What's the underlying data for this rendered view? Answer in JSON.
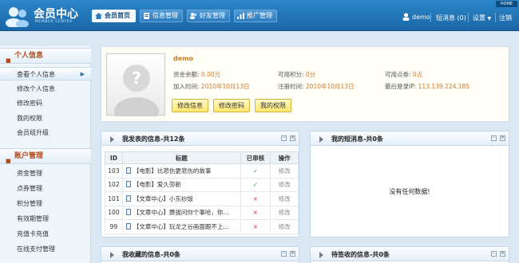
{
  "header": {
    "logo_title": "会员中心",
    "logo_subtitle": "MEMBER CENTER",
    "home_link": "HOME",
    "tabs": [
      {
        "label": "会员首页",
        "icon": "home-icon",
        "active": true
      },
      {
        "label": "信息管理",
        "icon": "document-icon",
        "active": false
      },
      {
        "label": "好友管理",
        "icon": "users-icon",
        "active": false
      },
      {
        "label": "推广管理",
        "icon": "chart-icon",
        "active": false
      }
    ],
    "username": "demo",
    "messages": "短消息 (0)",
    "settings": "设置",
    "logout": "注销"
  },
  "sidebar": {
    "sections": [
      {
        "title": "个人信息",
        "items": [
          "查看个人信息",
          "修改个人信息",
          "修改密码",
          "我的权限",
          "会员组升级"
        ]
      },
      {
        "title": "账户管理",
        "items": [
          "资金管理",
          "点券管理",
          "积分管理",
          "有效期管理",
          "充值卡充值",
          "在线支付管理"
        ]
      }
    ]
  },
  "profile": {
    "username": "demo",
    "balance_label": "资金余额:",
    "balance_value": "0.00元",
    "points_label": "可用积分:",
    "points_value": "0分",
    "coupons_label": "可用点券:",
    "coupons_value": "0点",
    "join_label": "加入时间:",
    "join_value": "2010年10月13日",
    "reg_label": "注册时间:",
    "reg_value": "2010年10月13日",
    "lastip_label": "最后登录IP:",
    "lastip_value": "113.139.224.185",
    "buttons": [
      "修改信息",
      "修改密码",
      "我的权限"
    ]
  },
  "panels": {
    "published": {
      "title": "我发表的信息-共12条",
      "columns": [
        "ID",
        "标题",
        "已审核",
        "操作"
      ],
      "rows": [
        {
          "id": "103",
          "title": "【电影】比悲伤更悲伤的故事",
          "approved": "✓",
          "op": "修改"
        },
        {
          "id": "102",
          "title": "【电影】爱久弥新",
          "approved": "✓",
          "op": "修改"
        },
        {
          "id": "101",
          "title": "【文章中心】小东纱饭",
          "approved": "×",
          "op": "修改"
        },
        {
          "id": "100",
          "title": "【文章中心】葬拔问你个事哈，你...",
          "approved": "×",
          "op": "修改"
        },
        {
          "id": "99",
          "title": "【文章中心】玩龙之谷画面跟不上...",
          "approved": "×",
          "op": "修改"
        }
      ]
    },
    "short_messages": {
      "title": "我的短消息-共0条",
      "empty": "没有任何数据!"
    },
    "favorites": {
      "title": "我收藏的信息-共0条"
    },
    "pending_sign": {
      "title": "待签收的信息-共0条"
    }
  }
}
